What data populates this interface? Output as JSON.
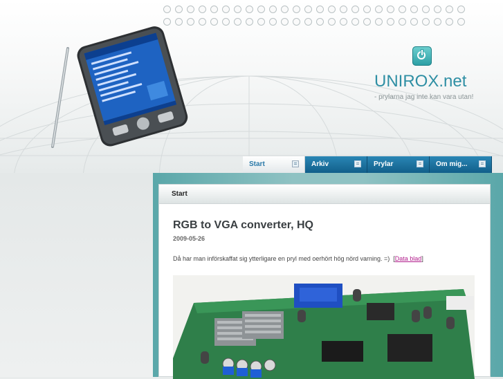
{
  "site": {
    "title": "UNIROX.net",
    "tagline": "- prylarna jag inte kan vara utan!"
  },
  "nav": {
    "items": [
      {
        "label": "Start",
        "active": true
      },
      {
        "label": "Arkiv",
        "active": false
      },
      {
        "label": "Prylar",
        "active": false
      },
      {
        "label": "Om mig...",
        "active": false
      }
    ]
  },
  "panel": {
    "heading": "Start"
  },
  "post": {
    "title": "RGB to VGA converter, HQ",
    "date": "2009-05-26",
    "body": "Då har man införskaffat sig ytterligare en pryl med oerhört hög nörd varning. =)",
    "link_open": "[",
    "link_label": "Data blad",
    "link_close": "]"
  },
  "colors": {
    "accent": "#2f8fa4",
    "nav_bg": "#1f76a3",
    "link": "#b01a8a",
    "frame": "#6fb2b3"
  }
}
